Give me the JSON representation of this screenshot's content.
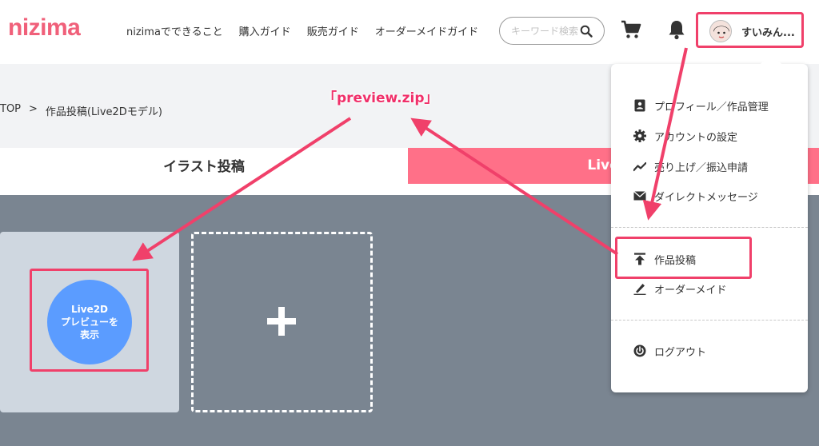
{
  "header": {
    "logo": "nizima",
    "nav": [
      "nizimaでできること",
      "購入ガイド",
      "販売ガイド",
      "オーダーメイドガイド"
    ],
    "search_placeholder": "キーワード検索",
    "user_name": "すいみん..."
  },
  "breadcrumb": {
    "home": "TOP",
    "separator": ">",
    "current": "作品投稿(Live2Dモデル)"
  },
  "tabs": {
    "illust": "イラスト投稿",
    "live2d": "Live2D"
  },
  "upload": {
    "preview_button": [
      "Live2D",
      "プレビューを",
      "表示"
    ],
    "add_symbol": "+"
  },
  "dropdown": {
    "items": [
      {
        "label": "プロフィール／作品管理",
        "icon": "id-card-icon"
      },
      {
        "label": "アカウントの設定",
        "icon": "gear-icon"
      },
      {
        "label": "売り上げ／振込申請",
        "icon": "trend-line-icon"
      },
      {
        "label": "ダイレクトメッセージ",
        "icon": "envelope-icon"
      },
      {
        "label": "作品投稿",
        "icon": "upload-icon"
      },
      {
        "label": "オーダーメイド",
        "icon": "pen-icon"
      },
      {
        "label": "ログアウト",
        "icon": "power-icon"
      }
    ]
  },
  "annotation": {
    "label": "「preview.zip」",
    "color": "#f0406a"
  },
  "colors": {
    "brand": "#f0607a",
    "tab_active": "#ff7088",
    "main_bg": "#7a8591",
    "preview_button": "#5b9cff"
  }
}
